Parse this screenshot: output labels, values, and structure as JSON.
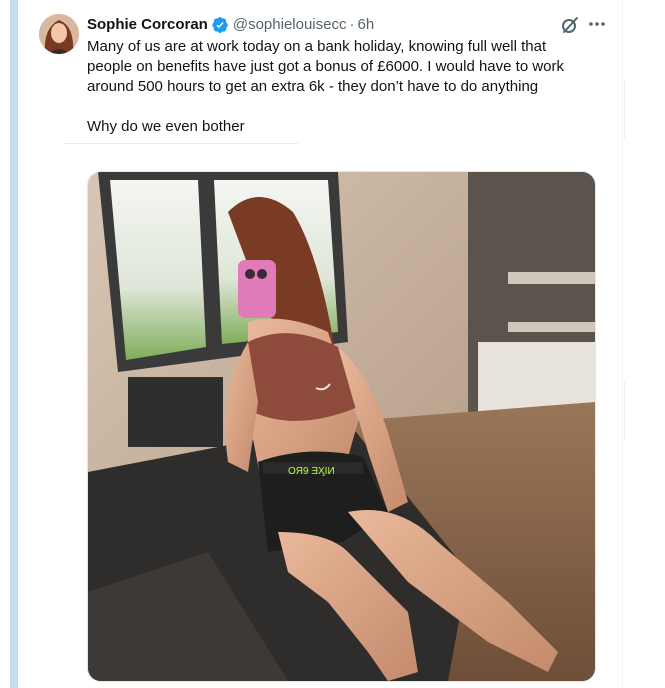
{
  "tweet": {
    "display_name": "Sophie Corcoran",
    "handle": "@sophielouisecc",
    "separator": "·",
    "time": "6h",
    "text_lines": [
      "Many of us are at work today on a bank holiday, knowing full well that",
      "people on benefits have just got a bonus of £6000. I would have to work",
      "around 500 hours to get an extra 6k - they don’t have to do anything"
    ],
    "text_last": "Why do we even bother",
    "more_icon": "more-horizontal-icon",
    "grok_icon": "grok-icon",
    "verified_icon": "verified-badge-icon",
    "verified_color": "#1d9bf0"
  },
  "media": {
    "alt": "photo"
  }
}
